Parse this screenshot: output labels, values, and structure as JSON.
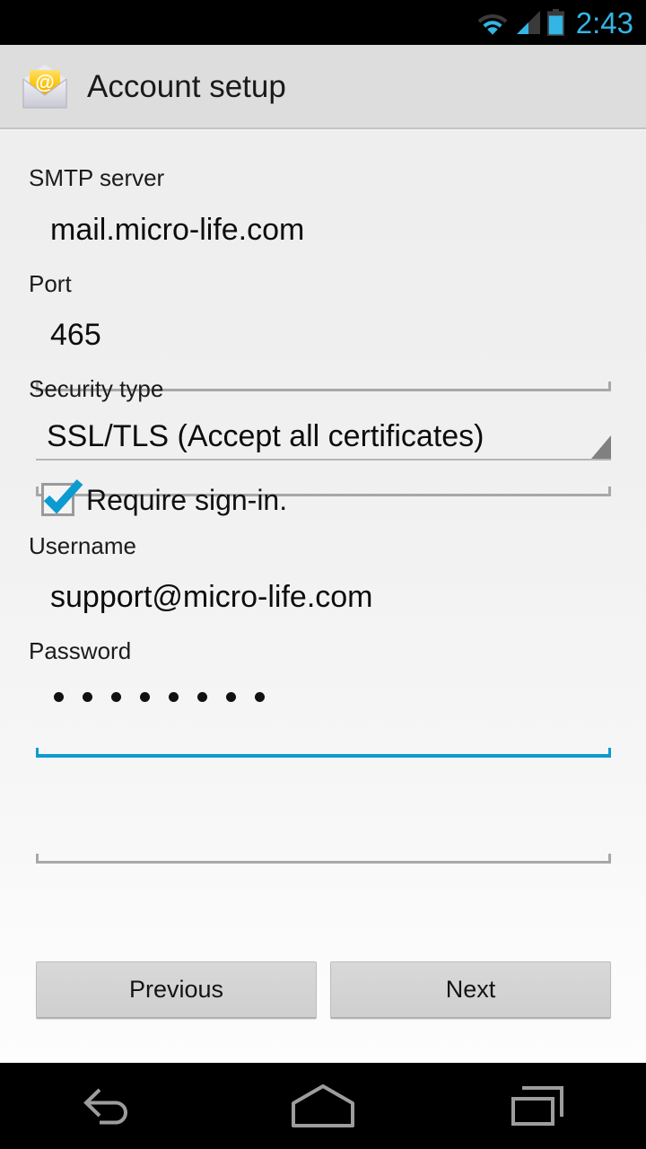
{
  "status_bar": {
    "time": "2:43",
    "icons": [
      "wifi-icon",
      "cellular-signal-icon",
      "battery-icon"
    ],
    "time_color": "#33b5e5",
    "accent_color": "#33b5e5"
  },
  "title_bar": {
    "icon": "email-envelope-at-icon",
    "title": "Account setup"
  },
  "form": {
    "fields": [
      {
        "name": "smtp-server",
        "label": "SMTP server",
        "value": "mail.micro-life.com",
        "type": "text",
        "focused": false
      },
      {
        "name": "port",
        "label": "Port",
        "value": "465",
        "type": "text",
        "focused": false
      },
      {
        "name": "security-type",
        "label": "Security type",
        "value": "SSL/TLS (Accept all certificates)",
        "type": "spinner",
        "focused": false
      },
      {
        "name": "username",
        "label": "Username",
        "value": "support@micro-life.com",
        "type": "text",
        "focused": true
      },
      {
        "name": "password",
        "label": "Password",
        "value": "••••••••",
        "masked_char_count": 8,
        "type": "password",
        "focused": false
      }
    ],
    "checkbox": {
      "name": "require-sign-in",
      "label": "Require sign-in.",
      "checked": true,
      "check_color": "#0b9bd0"
    }
  },
  "buttons": {
    "previous": "Previous",
    "next": "Next"
  },
  "nav_bar": {
    "back": "back-icon",
    "home": "home-icon",
    "recents": "recents-icon"
  }
}
